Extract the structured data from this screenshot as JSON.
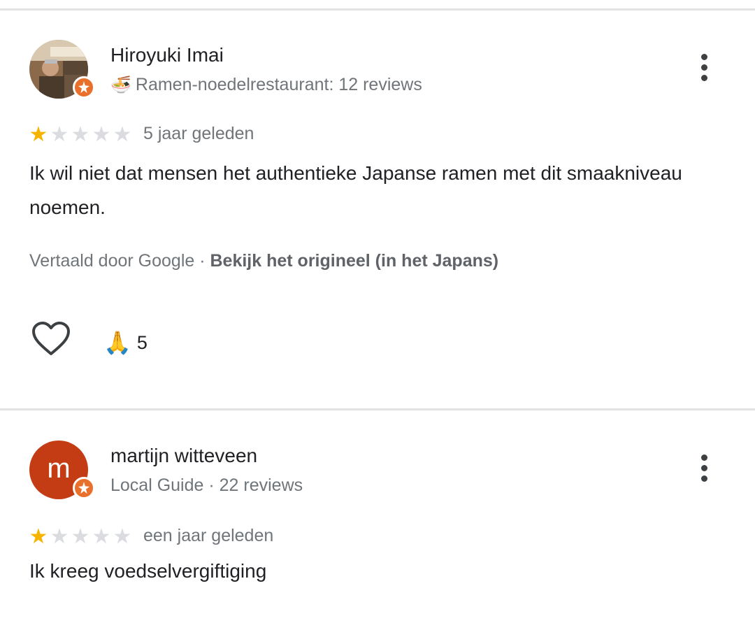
{
  "reviews": [
    {
      "author": "Hiroyuki Imai",
      "avatar_type": "photo",
      "subtitle_emoji": "🍜",
      "subtitle": "Ramen-noedelrestaurant: 12 reviews",
      "rating": 1,
      "max_rating": 5,
      "date": "5 jaar geleden",
      "text": "Ik wil niet dat mensen het authentieke Japanse ramen met dit smaakniveau noemen.",
      "translated_label": "Vertaald door Google · ",
      "original_link": "Bekijk het origineel (in het Japans)",
      "reaction_emoji": "🙏",
      "reaction_count": "5",
      "badge_color": "#e8702a"
    },
    {
      "author": "martijn witteveen",
      "avatar_type": "letter",
      "avatar_letter": "m",
      "avatar_color": "#c33c13",
      "subtitle": "Local Guide · 22 reviews",
      "rating": 1,
      "max_rating": 5,
      "date": "een jaar geleden",
      "text": "Ik kreeg voedselvergiftiging",
      "badge_color": "#e8702a"
    }
  ],
  "icons": {
    "more": "more-vert-icon",
    "like": "heart-outline-icon",
    "badge": "local-guide-star-icon"
  }
}
